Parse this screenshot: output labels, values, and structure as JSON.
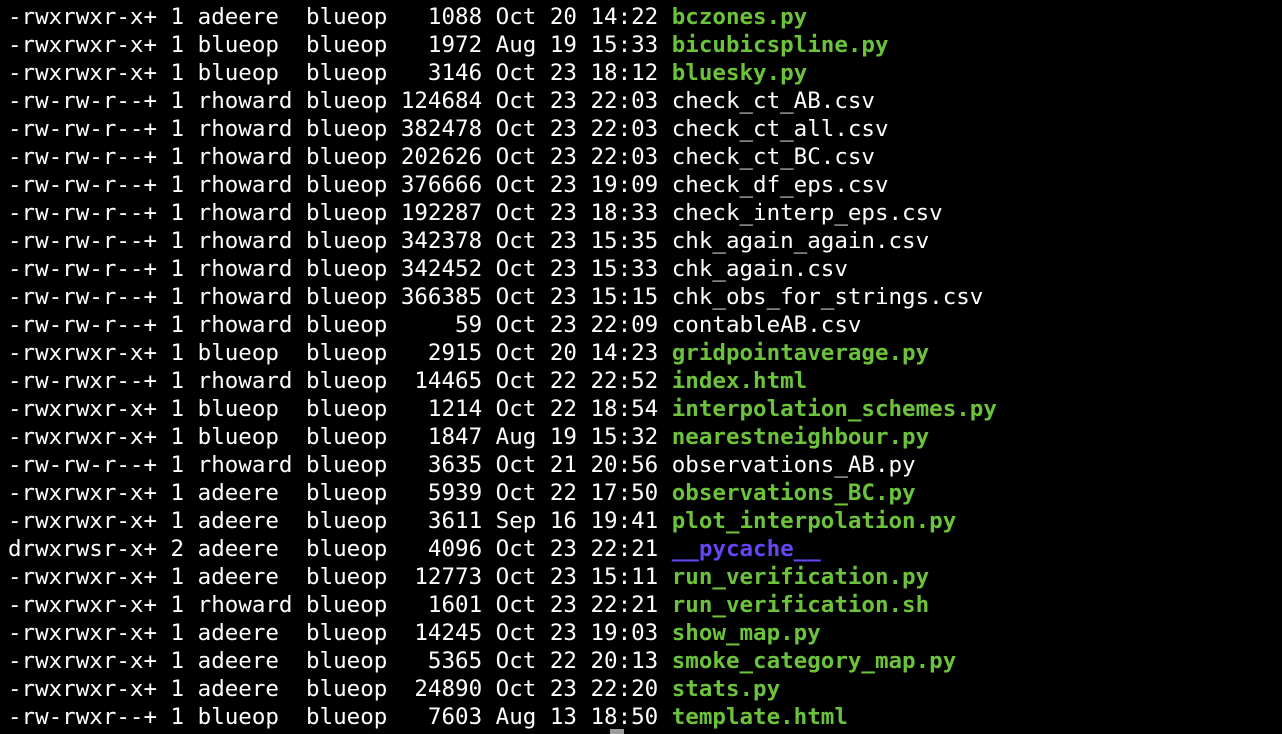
{
  "colors": {
    "background": "#000000",
    "text": "#ffffff",
    "executable": "#6cc33b",
    "directory": "#6645f2",
    "cursor": "#9a9a9a"
  },
  "listing": [
    {
      "perms": "-rwxrwxr-x+",
      "links": "1",
      "owner": "adeere",
      "group": "blueop",
      "size": "1088",
      "date": "Oct 20 14:22",
      "name": "bczones.py",
      "kind": "exec"
    },
    {
      "perms": "-rwxrwxr-x+",
      "links": "1",
      "owner": "blueop",
      "group": "blueop",
      "size": "1972",
      "date": "Aug 19 15:33",
      "name": "bicubicspline.py",
      "kind": "exec"
    },
    {
      "perms": "-rwxrwxr-x+",
      "links": "1",
      "owner": "blueop",
      "group": "blueop",
      "size": "3146",
      "date": "Oct 23 18:12",
      "name": "bluesky.py",
      "kind": "exec"
    },
    {
      "perms": "-rw-rw-r--+",
      "links": "1",
      "owner": "rhoward",
      "group": "blueop",
      "size": "124684",
      "date": "Oct 23 22:03",
      "name": "check_ct_AB.csv",
      "kind": "plain"
    },
    {
      "perms": "-rw-rw-r--+",
      "links": "1",
      "owner": "rhoward",
      "group": "blueop",
      "size": "382478",
      "date": "Oct 23 22:03",
      "name": "check_ct_all.csv",
      "kind": "plain"
    },
    {
      "perms": "-rw-rw-r--+",
      "links": "1",
      "owner": "rhoward",
      "group": "blueop",
      "size": "202626",
      "date": "Oct 23 22:03",
      "name": "check_ct_BC.csv",
      "kind": "plain"
    },
    {
      "perms": "-rw-rw-r--+",
      "links": "1",
      "owner": "rhoward",
      "group": "blueop",
      "size": "376666",
      "date": "Oct 23 19:09",
      "name": "check_df_eps.csv",
      "kind": "plain"
    },
    {
      "perms": "-rw-rw-r--+",
      "links": "1",
      "owner": "rhoward",
      "group": "blueop",
      "size": "192287",
      "date": "Oct 23 18:33",
      "name": "check_interp_eps.csv",
      "kind": "plain"
    },
    {
      "perms": "-rw-rw-r--+",
      "links": "1",
      "owner": "rhoward",
      "group": "blueop",
      "size": "342378",
      "date": "Oct 23 15:35",
      "name": "chk_again_again.csv",
      "kind": "plain"
    },
    {
      "perms": "-rw-rw-r--+",
      "links": "1",
      "owner": "rhoward",
      "group": "blueop",
      "size": "342452",
      "date": "Oct 23 15:33",
      "name": "chk_again.csv",
      "kind": "plain"
    },
    {
      "perms": "-rw-rw-r--+",
      "links": "1",
      "owner": "rhoward",
      "group": "blueop",
      "size": "366385",
      "date": "Oct 23 15:15",
      "name": "chk_obs_for_strings.csv",
      "kind": "plain"
    },
    {
      "perms": "-rw-rw-r--+",
      "links": "1",
      "owner": "rhoward",
      "group": "blueop",
      "size": "59",
      "date": "Oct 23 22:09",
      "name": "contableAB.csv",
      "kind": "plain"
    },
    {
      "perms": "-rwxrwxr-x+",
      "links": "1",
      "owner": "blueop",
      "group": "blueop",
      "size": "2915",
      "date": "Oct 20 14:23",
      "name": "gridpointaverage.py",
      "kind": "exec"
    },
    {
      "perms": "-rw-rwxr--+",
      "links": "1",
      "owner": "rhoward",
      "group": "blueop",
      "size": "14465",
      "date": "Oct 22 22:52",
      "name": "index.html",
      "kind": "exec"
    },
    {
      "perms": "-rwxrwxr-x+",
      "links": "1",
      "owner": "blueop",
      "group": "blueop",
      "size": "1214",
      "date": "Oct 22 18:54",
      "name": "interpolation_schemes.py",
      "kind": "exec"
    },
    {
      "perms": "-rwxrwxr-x+",
      "links": "1",
      "owner": "blueop",
      "group": "blueop",
      "size": "1847",
      "date": "Aug 19 15:32",
      "name": "nearestneighbour.py",
      "kind": "exec"
    },
    {
      "perms": "-rw-rw-r--+",
      "links": "1",
      "owner": "rhoward",
      "group": "blueop",
      "size": "3635",
      "date": "Oct 21 20:56",
      "name": "observations_AB.py",
      "kind": "plain"
    },
    {
      "perms": "-rwxrwxr-x+",
      "links": "1",
      "owner": "adeere",
      "group": "blueop",
      "size": "5939",
      "date": "Oct 22 17:50",
      "name": "observations_BC.py",
      "kind": "exec"
    },
    {
      "perms": "-rwxrwxr-x+",
      "links": "1",
      "owner": "adeere",
      "group": "blueop",
      "size": "3611",
      "date": "Sep 16 19:41",
      "name": "plot_interpolation.py",
      "kind": "exec"
    },
    {
      "perms": "drwxrwsr-x+",
      "links": "2",
      "owner": "adeere",
      "group": "blueop",
      "size": "4096",
      "date": "Oct 23 22:21",
      "name": "__pycache__",
      "kind": "dir"
    },
    {
      "perms": "-rwxrwxr-x+",
      "links": "1",
      "owner": "adeere",
      "group": "blueop",
      "size": "12773",
      "date": "Oct 23 15:11",
      "name": "run_verification.py",
      "kind": "exec"
    },
    {
      "perms": "-rwxrwxr-x+",
      "links": "1",
      "owner": "rhoward",
      "group": "blueop",
      "size": "1601",
      "date": "Oct 23 22:21",
      "name": "run_verification.sh",
      "kind": "exec"
    },
    {
      "perms": "-rwxrwxr-x+",
      "links": "1",
      "owner": "adeere",
      "group": "blueop",
      "size": "14245",
      "date": "Oct 23 19:03",
      "name": "show_map.py",
      "kind": "exec"
    },
    {
      "perms": "-rwxrwxr-x+",
      "links": "1",
      "owner": "adeere",
      "group": "blueop",
      "size": "5365",
      "date": "Oct 22 20:13",
      "name": "smoke_category_map.py",
      "kind": "exec"
    },
    {
      "perms": "-rwxrwxr-x+",
      "links": "1",
      "owner": "adeere",
      "group": "blueop",
      "size": "24890",
      "date": "Oct 23 22:20",
      "name": "stats.py",
      "kind": "exec"
    },
    {
      "perms": "-rw-rwxr--+",
      "links": "1",
      "owner": "blueop",
      "group": "blueop",
      "size": "7603",
      "date": "Aug 13 18:50",
      "name": "template.html",
      "kind": "exec"
    }
  ]
}
